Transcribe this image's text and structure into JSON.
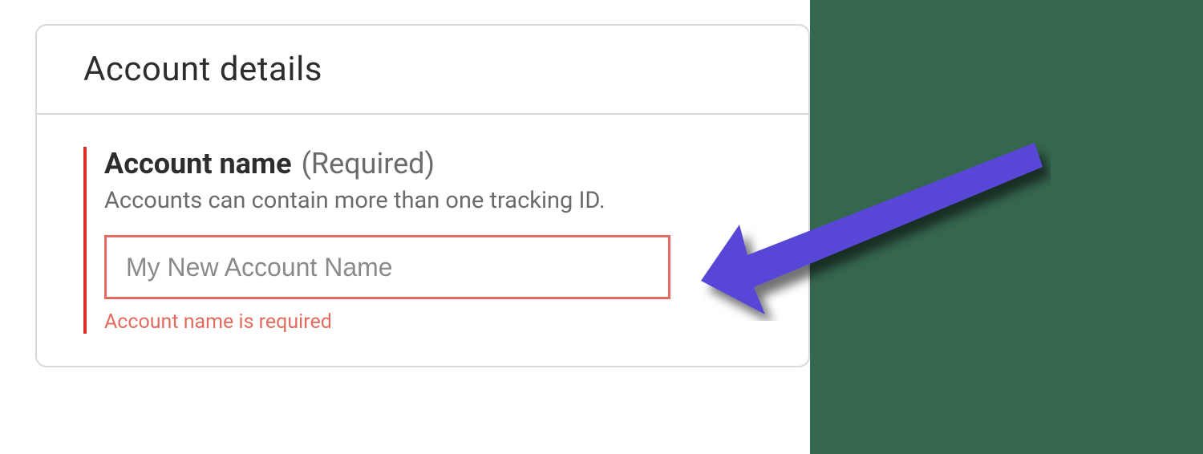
{
  "card": {
    "title": "Account details"
  },
  "field": {
    "label": "Account name",
    "required_text": "(Required)",
    "description": "Accounts can contain more than one tracking ID.",
    "placeholder": "My New Account Name",
    "value": "",
    "error": "Account name is required"
  },
  "annotation": {
    "arrow_name": "callout-arrow",
    "arrow_color": "#5947d6"
  }
}
